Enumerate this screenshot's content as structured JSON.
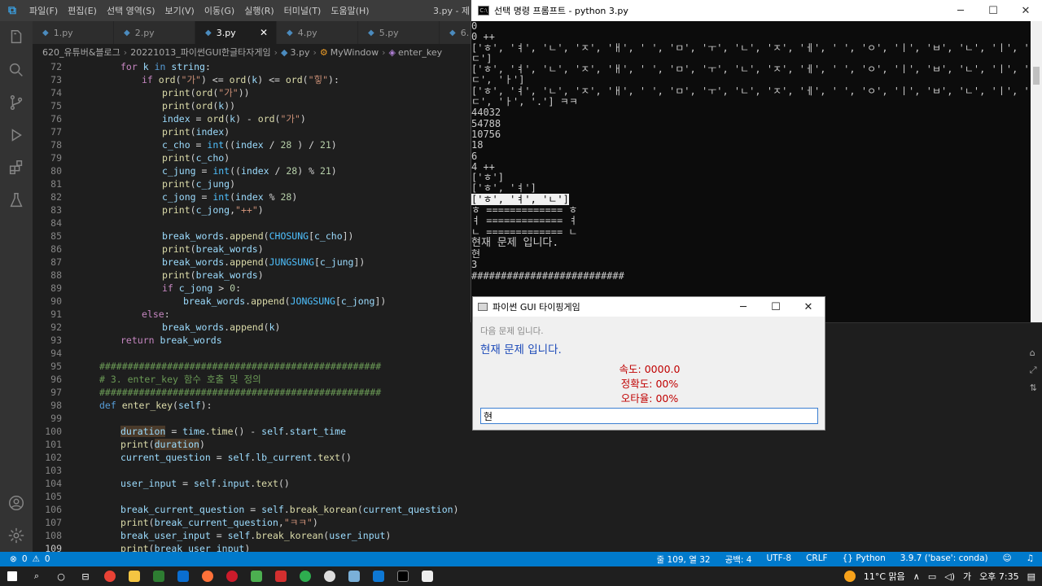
{
  "vscode": {
    "menu": [
      "파일(F)",
      "편집(E)",
      "선택 영역(S)",
      "보기(V)",
      "이동(G)",
      "실행(R)",
      "터미널(T)",
      "도움말(H)"
    ],
    "window_title_fragment": "3.py - 제",
    "tabs": [
      {
        "label": "1.py"
      },
      {
        "label": "2.py"
      },
      {
        "label": "3.py",
        "close": "✕"
      },
      {
        "label": "4.py"
      },
      {
        "label": "5.py"
      },
      {
        "label": "6."
      }
    ],
    "breadcrumb": [
      "620_유튜버&블로그",
      "20221013_파이썬GUI한글타자게임",
      "3.py",
      "MyWindow",
      "enter_key"
    ],
    "gutter": [
      72,
      73,
      74,
      75,
      76,
      77,
      78,
      79,
      80,
      81,
      82,
      83,
      84,
      85,
      86,
      87,
      88,
      89,
      90,
      91,
      92,
      93,
      94,
      95,
      96,
      97,
      98,
      99,
      100,
      101,
      102,
      103,
      104,
      105,
      106,
      107,
      108,
      109
    ]
  },
  "console": {
    "title": "선택 명령 프롬프트 - python  3.py",
    "lines": [
      "0",
      "0 ++",
      "['ㅎ', 'ㅕ', 'ㄴ', 'ㅈ', 'ㅐ', ' ', 'ㅁ', 'ㅜ', 'ㄴ', 'ㅈ', 'ㅔ', ' ', 'ㅇ', 'ㅣ', 'ㅂ', 'ㄴ', 'ㅣ', '",
      "ㄷ']",
      "['ㅎ', 'ㅕ', 'ㄴ', 'ㅈ', 'ㅐ', ' ', 'ㅁ', 'ㅜ', 'ㄴ', 'ㅈ', 'ㅔ', ' ', 'ㅇ', 'ㅣ', 'ㅂ', 'ㄴ', 'ㅣ', '",
      "ㄷ', 'ㅏ']",
      "['ㅎ', 'ㅕ', 'ㄴ', 'ㅈ', 'ㅐ', ' ', 'ㅁ', 'ㅜ', 'ㄴ', 'ㅈ', 'ㅔ', ' ', 'ㅇ', 'ㅣ', 'ㅂ', 'ㄴ', 'ㅣ', '",
      "ㄷ', 'ㅏ', '.'] ㅋㅋ",
      "44032",
      "54788",
      "10756",
      "18",
      "6",
      "4 ++",
      "['ㅎ']",
      "['ㅎ', 'ㅕ']",
      "['ㅎ', 'ㅕ', 'ㄴ']",
      "ㅎ ============= ㅎ",
      "ㅕ ============= ㅕ",
      "ㄴ ============= ㄴ",
      "현재 문제 입니다.",
      "현",
      "3",
      "##########################"
    ]
  },
  "gui": {
    "title": "파이썬 GUI 타이핑게임",
    "next_question": "다음 문제 입니다.",
    "current_question": "현재 문제 입니다.",
    "speed": "속도: 0000.0",
    "accuracy": "정확도: 00%",
    "error_rate": "오타율: 00%",
    "input_value": "현"
  },
  "statusbar": {
    "errors": "0",
    "warnings": "0",
    "position": "줄 109, 열 32",
    "spaces": "공백: 4",
    "encoding": "UTF-8",
    "eol": "CRLF",
    "language": "Python",
    "interpreter": "3.9.7 ('base': conda)"
  },
  "taskbar": {
    "weather": "11°C 맑음",
    "ime": "가",
    "time": "오후 7:35"
  },
  "colors": {
    "vscode_accent": "#007acc",
    "gui_current_text": "#1c4ab8",
    "gui_stats_text": "#c00000"
  }
}
